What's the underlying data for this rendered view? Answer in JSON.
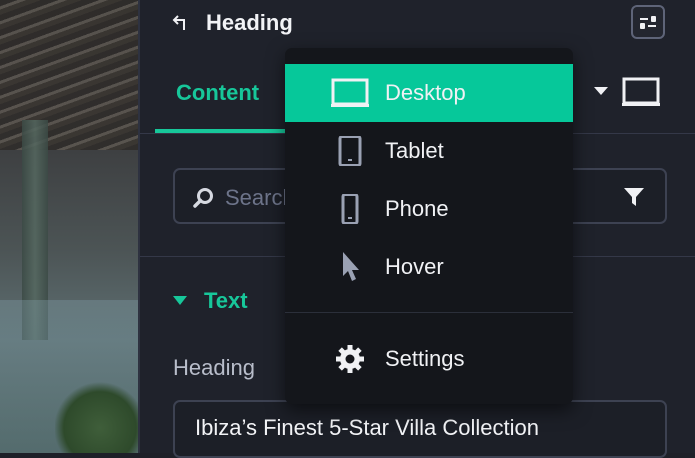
{
  "panel": {
    "title": "Heading",
    "tabs": [
      {
        "label": "Content",
        "active": true
      }
    ],
    "search_placeholder": "Search",
    "section_title": "Text",
    "heading_field_label": "Heading",
    "heading_field_value": "Ibiza’s Finest 5-Star Villa Collection"
  },
  "device_menu": {
    "items": [
      {
        "label": "Desktop",
        "icon": "desktop-icon",
        "selected": true
      },
      {
        "label": "Tablet",
        "icon": "tablet-icon",
        "selected": false
      },
      {
        "label": "Phone",
        "icon": "phone-icon",
        "selected": false
      },
      {
        "label": "Hover",
        "icon": "cursor-icon",
        "selected": false
      },
      {
        "label": "Settings",
        "icon": "gear-icon",
        "selected": false
      }
    ]
  },
  "colors": {
    "accent": "#17c79a",
    "menu_active": "#06c89a",
    "panel_bg": "#1f222b",
    "menu_bg": "#14161b"
  }
}
